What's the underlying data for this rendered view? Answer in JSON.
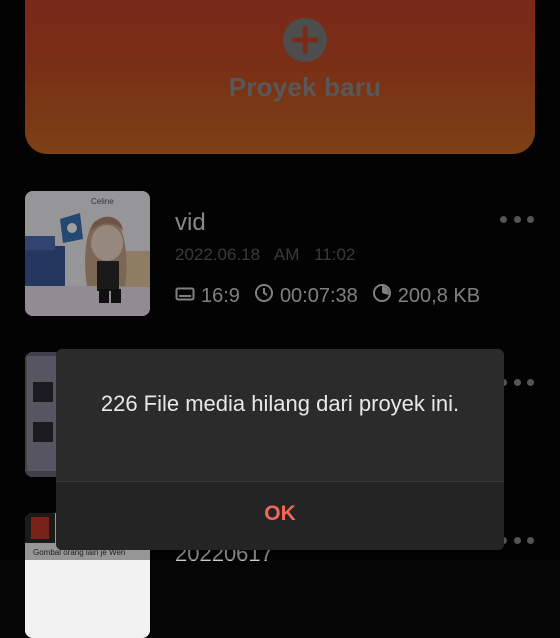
{
  "new_project": {
    "label": "Proyek baru",
    "icon": "plus-icon"
  },
  "projects": [
    {
      "name": "vid",
      "date": "2022.06.18 AM 11:02",
      "aspect": "16:9",
      "duration": "00:07:38",
      "size": "200,8 KB",
      "thumb_caption": "Celine"
    },
    {
      "name": "",
      "date": "",
      "aspect": "",
      "duration": "",
      "size": "",
      "thumb_caption": ""
    },
    {
      "name": "",
      "date": "20220617",
      "aspect": "",
      "duration": "",
      "size": "",
      "thumb_caption": "Gombal orang lain je Wen"
    }
  ],
  "dialog": {
    "message": "226 File media hilang dari proyek ini.",
    "ok_label": "OK"
  },
  "colors": {
    "background": "#050505",
    "banner_top": "#c8402c",
    "banner_bottom": "#c86a22",
    "dialog_bg": "#2b2b2b",
    "ok_accent": "#f0685a"
  }
}
